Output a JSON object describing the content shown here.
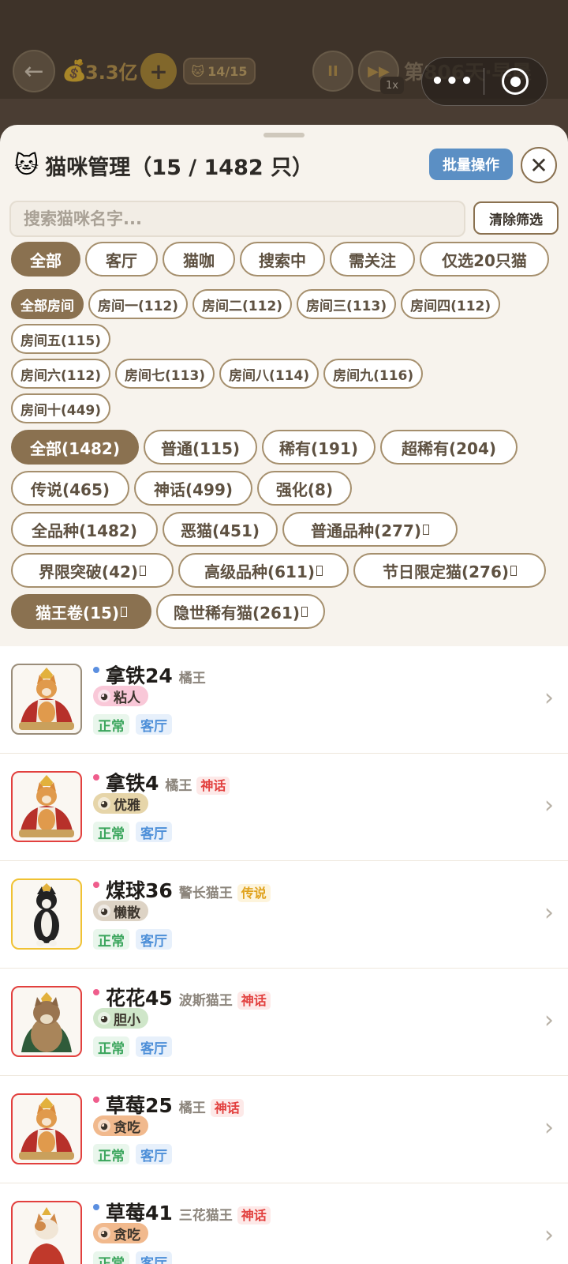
{
  "topbar": {
    "money": "3.3亿",
    "plus": "+",
    "cat_cap": "14/15",
    "pause": "II",
    "fast_forward": "▶▶",
    "speed": "1x",
    "day": "第806天·早晨",
    "more": "•••"
  },
  "sheet": {
    "title": "猫咪管理（15 / 1482 只）",
    "batch_label": "批量操作",
    "close": "✕",
    "search_placeholder": "搜索猫咪名字...",
    "clear_label": "清除筛选"
  },
  "tabs": [
    "全部",
    "客厅",
    "猫咖",
    "搜索中",
    "需关注",
    "仅选20只猫"
  ],
  "rooms": [
    [
      "全部房间",
      "房间一(112)",
      "房间二(112)",
      "房间三(113)",
      "房间四(112)"
    ],
    [
      "房间五(115)"
    ],
    [
      "房间六(112)",
      "房间七(113)",
      "房间八(114)",
      "房间九(116)"
    ],
    [
      "房间十(449)"
    ]
  ],
  "rarities": [
    [
      "全部(1482)",
      "普通(115)",
      "稀有(191)",
      "超稀有(204)"
    ],
    [
      "传说(465)",
      "神话(499)",
      "强化(8)"
    ]
  ],
  "breeds": [
    [
      "全品种(1482)",
      "恶猫(451)",
      "普通品种(277)"
    ],
    [
      "界限突破(42)",
      "高级品种(611)",
      "节日限定猫(276)"
    ],
    [
      "猫王卷(15)",
      "隐世稀有猫(261)"
    ]
  ],
  "cats": [
    {
      "name": "拿铁24",
      "breed": "橘王",
      "rarity": "",
      "trait": "粘人",
      "status": "正常",
      "location": "客厅",
      "dot": "#5b8fe0",
      "frame": "#9a8d7a",
      "trait_bg": "#f9c8d8",
      "kind": "king-orange"
    },
    {
      "name": "拿铁4",
      "breed": "橘王",
      "rarity": "神话",
      "trait": "优雅",
      "status": "正常",
      "location": "客厅",
      "dot": "#ef5d8c",
      "frame": "#e2403e",
      "trait_bg": "#e6d5a9",
      "kind": "king-orange"
    },
    {
      "name": "煤球36",
      "breed": "警长猫王",
      "rarity": "传说",
      "trait": "懒散",
      "status": "正常",
      "location": "客厅",
      "dot": "#ef5d8c",
      "frame": "#f0c233",
      "trait_bg": "#ddd3c5",
      "kind": "tuxedo"
    },
    {
      "name": "花花45",
      "breed": "波斯猫王",
      "rarity": "神话",
      "trait": "胆小",
      "status": "正常",
      "location": "客厅",
      "dot": "#ef5d8c",
      "frame": "#e2403e",
      "trait_bg": "#cfe6c9",
      "kind": "persian"
    },
    {
      "name": "草莓25",
      "breed": "橘王",
      "rarity": "神话",
      "trait": "贪吃",
      "status": "正常",
      "location": "客厅",
      "dot": "#ef5d8c",
      "frame": "#e2403e",
      "trait_bg": "#f1b98d",
      "kind": "king-orange"
    },
    {
      "name": "草莓41",
      "breed": "三花猫王",
      "rarity": "神话",
      "trait": "贪吃",
      "status": "正常",
      "location": "客厅",
      "dot": "#5b8fe0",
      "frame": "#e2403e",
      "trait_bg": "#f1b98d",
      "kind": "calico"
    }
  ],
  "icons": {
    "back": "←",
    "money": "money-bag-icon",
    "cat_head": "🐱",
    "chevron": "›"
  }
}
